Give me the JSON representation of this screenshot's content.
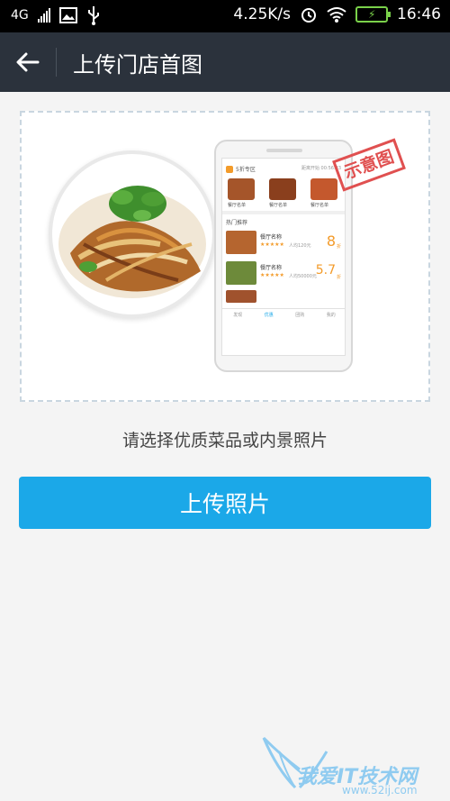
{
  "status_bar": {
    "network": "4G",
    "speed": "4.25K/s",
    "time": "16:46",
    "icons": [
      "signal-icon",
      "image-icon",
      "usb-icon",
      "alarm-icon",
      "wifi-icon",
      "battery-charging-icon"
    ]
  },
  "header": {
    "back_icon": "back-arrow-icon",
    "title": "上传门店首图"
  },
  "sample": {
    "stamp": "示意图",
    "phone_screen": {
      "section1_title": "5折专区",
      "section1_right": "距离开始 00:56:33",
      "dish_labels": [
        "餐厅名单",
        "餐厅名单",
        "餐厅名单"
      ],
      "section2_title": "热门推荐",
      "items": [
        {
          "name": "餐厅名称",
          "price": "人均120元",
          "rating": "8",
          "suffix": "折"
        },
        {
          "name": "餐厅名称",
          "price": "人均50000元",
          "rating": "5.7",
          "suffix": "折"
        }
      ],
      "tabs": [
        "发现",
        "优惠",
        "团购",
        "我的"
      ]
    }
  },
  "hint": "请选择优质菜品或内景照片",
  "upload_button": "上传照片",
  "watermark": {
    "main": "我爱IT技术网",
    "sub": "www.52ij.com"
  }
}
